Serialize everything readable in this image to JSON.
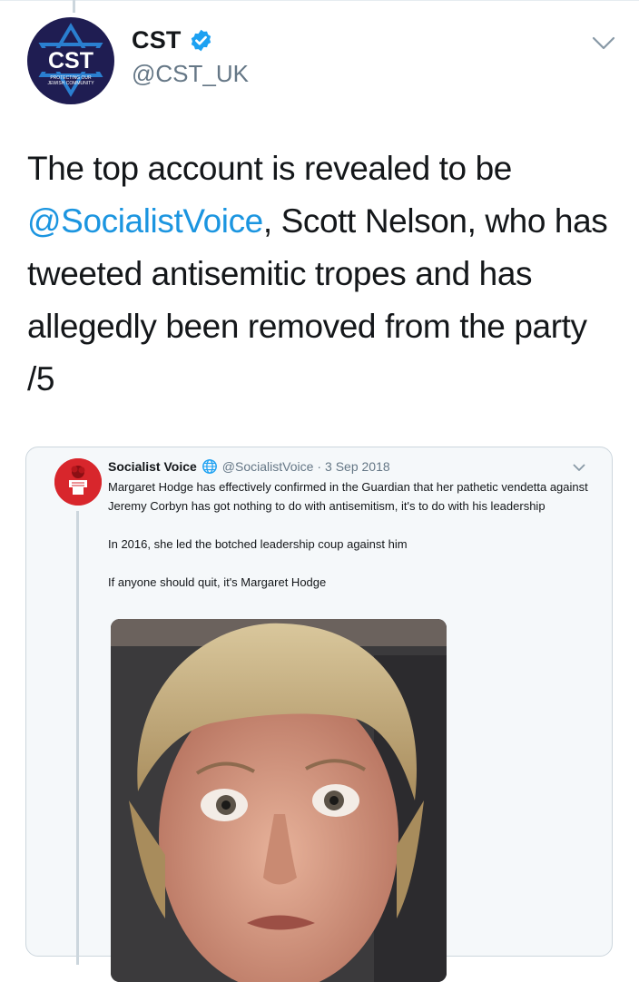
{
  "tweet": {
    "author_name": "CST",
    "author_handle": "@CST_UK",
    "avatar_text": "CST",
    "avatar_tagline_1": "PROTECTING OUR",
    "avatar_tagline_2": "JEWISH COMMUNITY",
    "text_part1": "The top account is revealed to be ",
    "mention": "@SocialistVoice",
    "text_part2": ", Scott Nelson, who has tweeted antisemitic tropes and has allegedly been removed from the party /5",
    "verified_icon": "verified-badge-icon",
    "menu_icon": "chevron-down-icon"
  },
  "quoted_tweet": {
    "author_name": "Socialist Voice",
    "author_handle": "@SocialistVoice",
    "separator": "·",
    "date": "3 Sep 2018",
    "paragraphs": [
      "Margaret Hodge has effectively confirmed in the Guardian that her pathetic vendetta against Jeremy Corbyn has got nothing to do with antisemitism, it's to do with his leadership",
      "In 2016, she led the botched leadership coup against him",
      "If anyone should quit, it's Margaret Hodge"
    ],
    "icons": {
      "globe": "globe-icon",
      "menu": "chevron-down-icon"
    }
  },
  "colors": {
    "link": "#1b95e0",
    "secondary_text": "#657786",
    "primary_text": "#14171a",
    "border": "#ccd6dd",
    "card_background": "#f5f8fa",
    "avatar_navy": "#1f1d52"
  }
}
